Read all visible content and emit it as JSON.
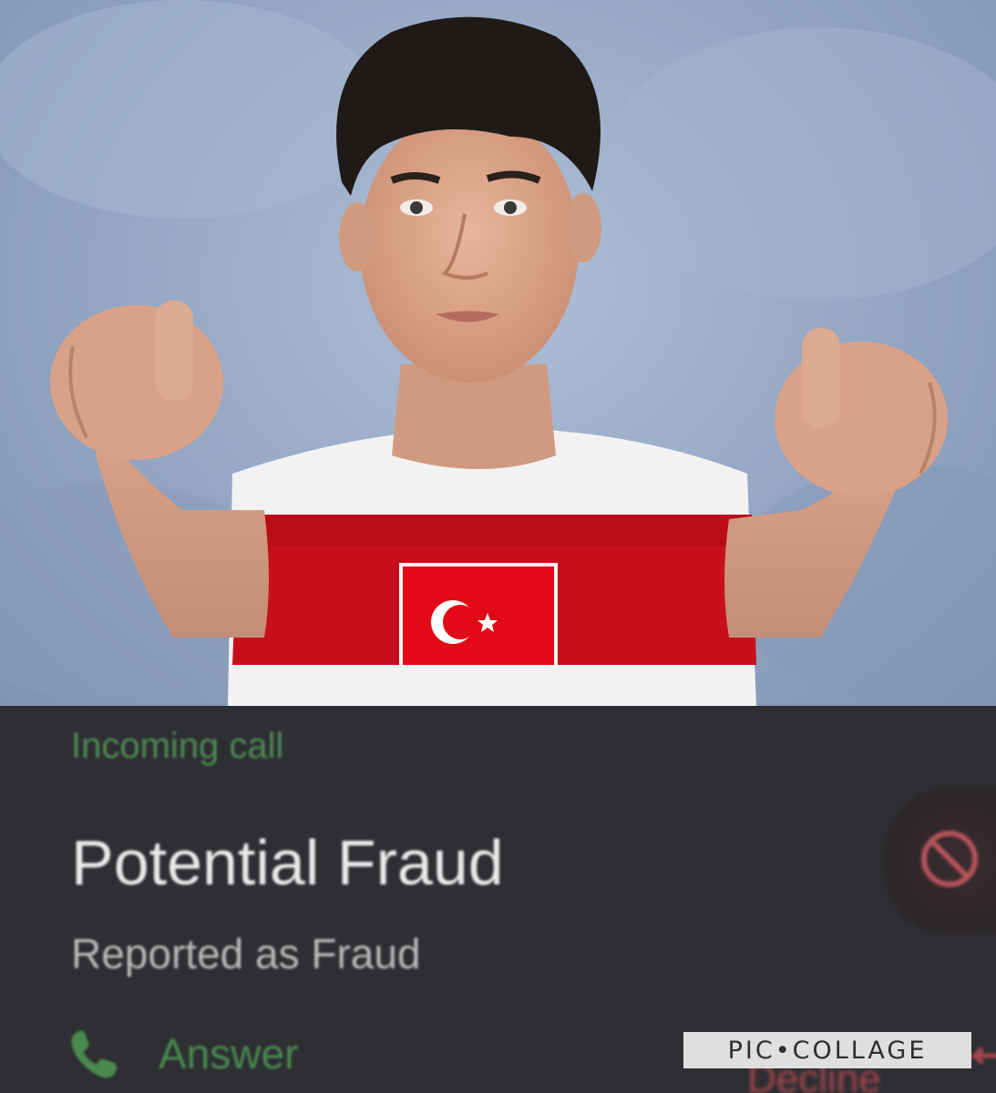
{
  "call": {
    "status_label": "Incoming call",
    "caller_name": "Potential Fraud",
    "caller_subtitle": "Reported as Fraud",
    "answer_label": "Answer",
    "decline_label": "Decline",
    "decline_icon": "block-icon",
    "answer_icon": "phone-icon"
  },
  "watermark": {
    "text": "PIC•COLLAGE"
  },
  "colors": {
    "status_green": "#4f8a52",
    "decline_red": "#a5464c",
    "panel_bg": "#2e2f33",
    "flag_red": "#e30a17"
  }
}
